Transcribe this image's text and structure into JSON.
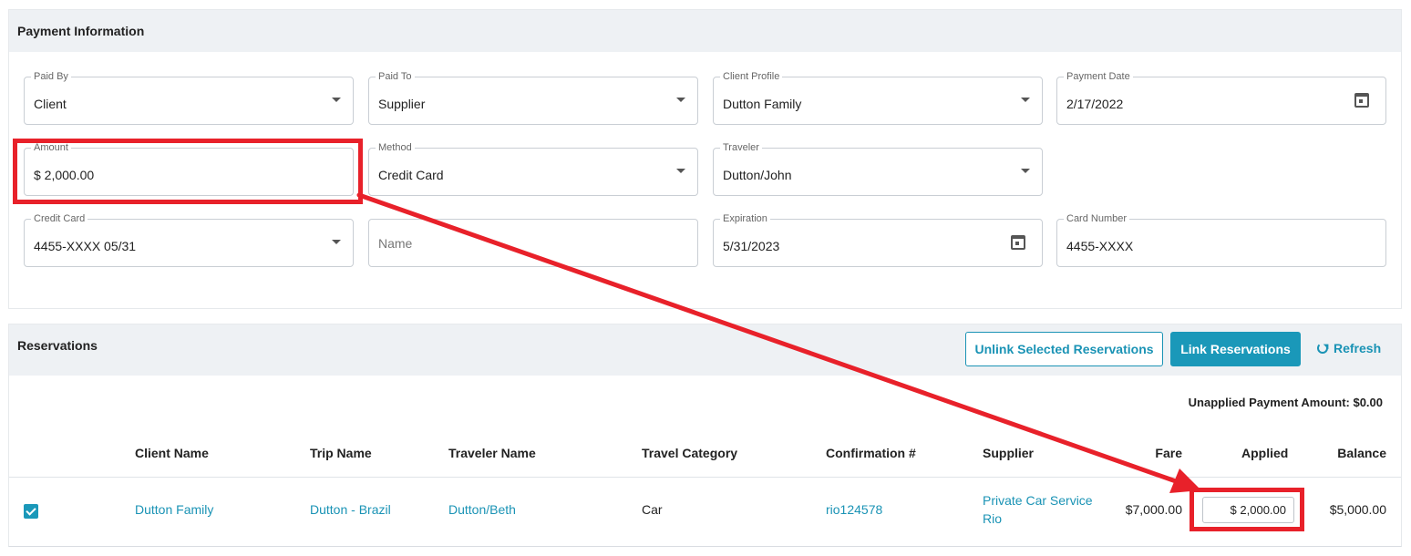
{
  "payment": {
    "title": "Payment Information",
    "fields": {
      "paid_by": {
        "label": "Paid By",
        "value": "Client"
      },
      "paid_to": {
        "label": "Paid To",
        "value": "Supplier"
      },
      "client_profile": {
        "label": "Client Profile",
        "value": "Dutton Family"
      },
      "payment_date": {
        "label": "Payment Date",
        "value": "2/17/2022"
      },
      "amount": {
        "label": "Amount",
        "value": "$ 2,000.00"
      },
      "method": {
        "label": "Method",
        "value": "Credit Card"
      },
      "traveler": {
        "label": "Traveler",
        "value": "Dutton/John"
      },
      "credit_card": {
        "label": "Credit Card",
        "value": "4455-XXXX 05/31"
      },
      "name": {
        "placeholder": "Name"
      },
      "expiration": {
        "label": "Expiration",
        "value": "5/31/2023"
      },
      "card_number": {
        "label": "Card Number",
        "value": "4455-XXXX"
      }
    }
  },
  "reservations": {
    "title": "Reservations",
    "unlink_label": "Unlink Selected Reservations",
    "link_label": "Link Reservations",
    "refresh_label": "Refresh",
    "unapplied": "Unapplied Payment Amount: $0.00",
    "columns": {
      "client_name": "Client Name",
      "trip_name": "Trip Name",
      "traveler_name": "Traveler Name",
      "travel_category": "Travel Category",
      "confirmation": "Confirmation #",
      "supplier": "Supplier",
      "fare": "Fare",
      "applied": "Applied",
      "balance": "Balance"
    },
    "rows": [
      {
        "checked": true,
        "client_name": "Dutton Family",
        "trip_name": "Dutton - Brazil",
        "traveler_name": "Dutton/Beth",
        "travel_category": "Car",
        "confirmation": "rio124578",
        "supplier_line1": "Private Car Service",
        "supplier_line2": "Rio",
        "fare": "$7,000.00",
        "applied": "$ 2,000.00",
        "balance": "$5,000.00"
      }
    ]
  },
  "colors": {
    "accent": "#1a98b9",
    "highlight": "#e8212a",
    "header_bg": "#eef1f4"
  }
}
